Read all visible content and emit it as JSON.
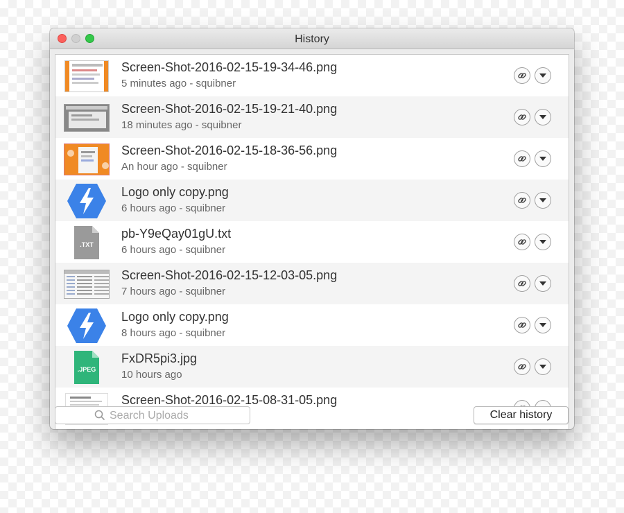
{
  "window": {
    "title": "History"
  },
  "items": [
    {
      "filename": "Screen-Shot-2016-02-15-19-34-46.png",
      "meta": "5 minutes ago - squibner",
      "thumb": "screenshot-orange"
    },
    {
      "filename": "Screen-Shot-2016-02-15-19-21-40.png",
      "meta": "18 minutes ago - squibner",
      "thumb": "screenshot-gray"
    },
    {
      "filename": "Screen-Shot-2016-02-15-18-36-56.png",
      "meta": "An hour ago - squibner",
      "thumb": "screenshot-orange-wide"
    },
    {
      "filename": "Logo only copy.png",
      "meta": "6 hours ago - squibner",
      "thumb": "logo-hexagon"
    },
    {
      "filename": "pb-Y9eQay01gU.txt",
      "meta": "6 hours ago - squibner",
      "thumb": "txt-file",
      "thumb_label": ".TXT"
    },
    {
      "filename": "Screen-Shot-2016-02-15-12-03-05.png",
      "meta": "7 hours ago - squibner",
      "thumb": "screenshot-table"
    },
    {
      "filename": "Logo only copy.png",
      "meta": "8 hours ago - squibner",
      "thumb": "logo-hexagon"
    },
    {
      "filename": "FxDR5pi3.jpg",
      "meta": "10 hours ago",
      "thumb": "jpeg-file",
      "thumb_label": ".JPEG"
    },
    {
      "filename": "Screen-Shot-2016-02-15-08-31-05.png",
      "meta": "",
      "thumb": "screenshot-doc"
    }
  ],
  "row_actions": {
    "link_icon": "link-icon",
    "menu_icon": "chevron-down-icon"
  },
  "search": {
    "placeholder": "Search Uploads"
  },
  "clear_button": {
    "label": "Clear history"
  },
  "colors": {
    "accent_blue": "#3b82e8",
    "jpeg_green": "#2fb57a",
    "txt_gray": "#9a9a9a",
    "orange": "#f08a24"
  }
}
